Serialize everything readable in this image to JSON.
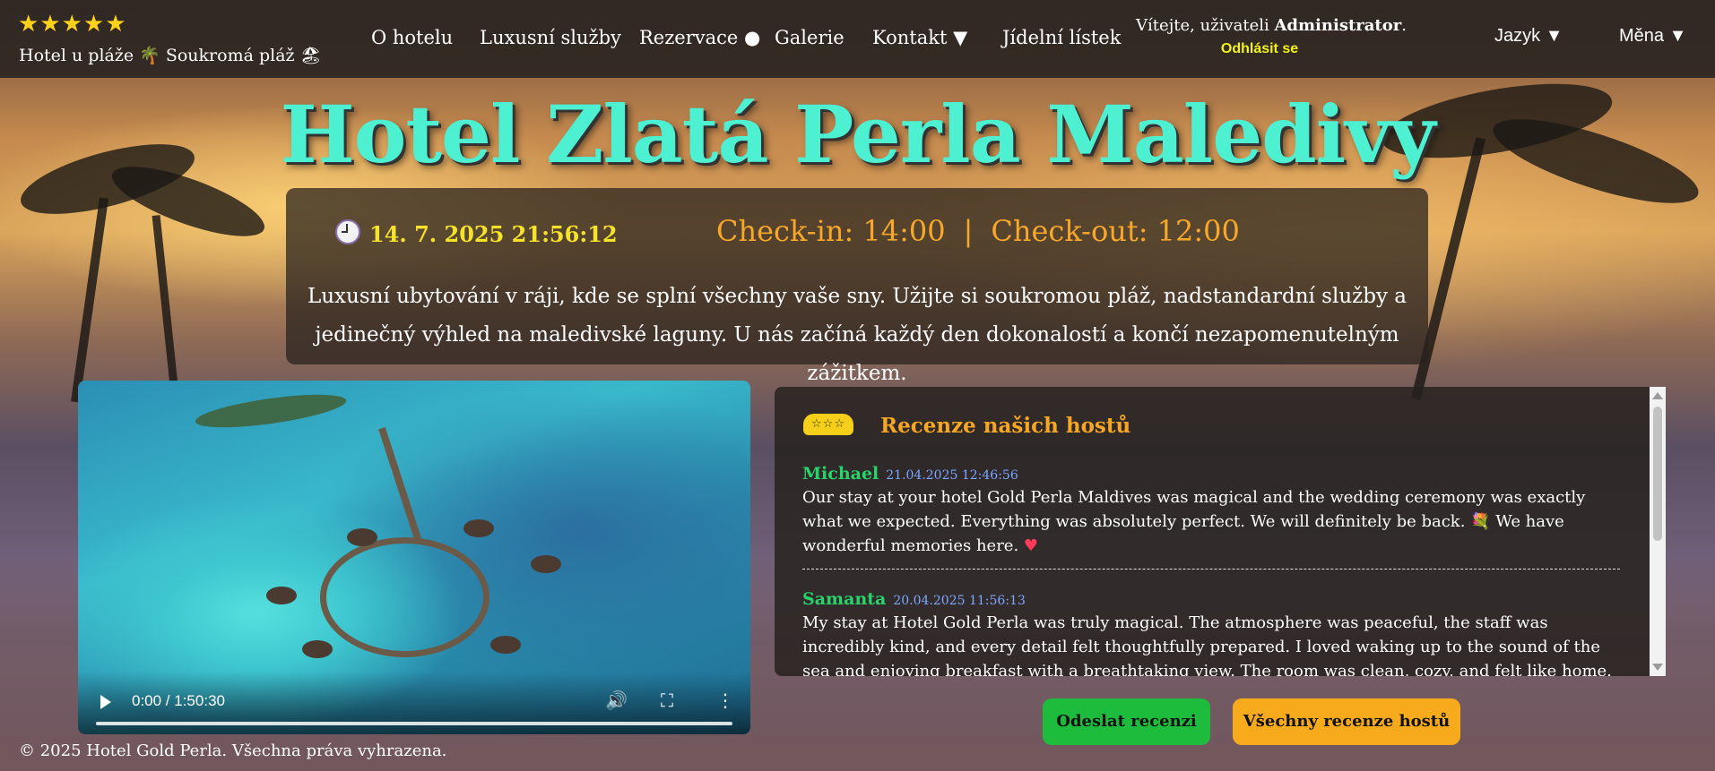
{
  "header": {
    "stars": "★★★★★",
    "tagline": "Hotel u pláže 🌴 Soukromá pláž 🏖",
    "nav": [
      "O hotelu",
      "Luxusní služby",
      "Rezervace ●",
      "Galerie",
      "Kontakt ▼",
      "Jídelní lístek"
    ],
    "welcome_prefix": "Vítejte, uživateli ",
    "username": "Administrator",
    "welcome_suffix": ".",
    "logout": "Odhlásit se",
    "language": "Jazyk ▼",
    "currency": "Měna ▼"
  },
  "hero": {
    "title": "Hotel Zlatá Perla Maledivy"
  },
  "info": {
    "datetime": "14. 7. 2025 21:56:12",
    "checkin": "Check-in: 14:00",
    "separator": "|",
    "checkout": "Check-out: 12:00",
    "description": "Luxusní ubytování v ráji, kde se splní všechny vaše sny. Užijte si soukromou pláž, nadstandardní služby a jedinečný výhled na maledivské laguny. U nás začíná každý den dokonalostí a končí nezapomenutelným zážitkem."
  },
  "video": {
    "time": "0:00 / 1:50:30",
    "progress": 0
  },
  "reviews": {
    "icon": "☆☆☆",
    "title": "Recenze našich hostů",
    "items": [
      {
        "name": "Michael",
        "date": "21.04.2025 12:46:56",
        "text": "Our stay at your hotel Gold Perla Maldives was magical and the wedding ceremony was exactly what we expected. Everything was absolutely perfect. We will definitely be back. 💐 We have wonderful memories here.",
        "emoji": "♥"
      },
      {
        "name": "Samanta",
        "date": "20.04.2025 11:56:13",
        "text": "My stay at Hotel Gold Perla was truly magical. The atmosphere was peaceful, the staff was incredibly kind, and every detail felt thoughtfully prepared. I loved waking up to the sound of the sea and enjoying breakfast with a breathtaking view. The room was clean, cozy, and felt like home. Thank you"
      }
    ]
  },
  "buttons": {
    "send": "Odeslat recenzi",
    "all": "Všechny recenze hostů"
  },
  "footer": {
    "copyright": "© 2025 Hotel Gold Perla. Všechna práva vyhrazena."
  },
  "colors": {
    "title": "#4ef0d2",
    "checkin": "#f7a82a",
    "clock": "#f6e22a",
    "review_name": "#27d36a",
    "review_date": "#7aa7ff",
    "send_button": "#1ebc3c",
    "all_button": "#f7aa1b"
  }
}
